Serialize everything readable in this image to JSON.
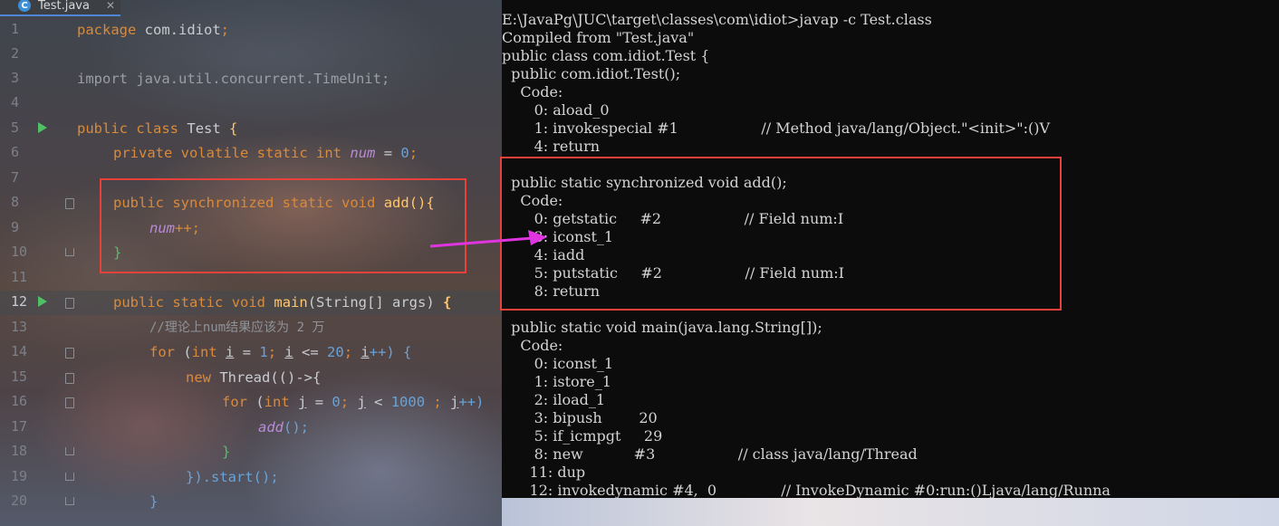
{
  "editor": {
    "tab": {
      "icon": "class-icon",
      "icon_letter": "C",
      "filename": "Test.java"
    },
    "lines": [
      {
        "n": "1"
      },
      {
        "n": "2"
      },
      {
        "n": "3"
      },
      {
        "n": "4"
      },
      {
        "n": "5"
      },
      {
        "n": "6"
      },
      {
        "n": "7"
      },
      {
        "n": "8"
      },
      {
        "n": "9"
      },
      {
        "n": "10"
      },
      {
        "n": "11"
      },
      {
        "n": "12"
      },
      {
        "n": "13"
      },
      {
        "n": "14"
      },
      {
        "n": "15"
      },
      {
        "n": "16"
      },
      {
        "n": "17"
      },
      {
        "n": "18"
      },
      {
        "n": "19"
      },
      {
        "n": "20"
      }
    ],
    "code": {
      "l1": {
        "kw": "package",
        "rest": " com.idiot",
        "semi": ";"
      },
      "l3": {
        "text": "import java.util.concurrent.TimeUnit;"
      },
      "l5": {
        "kw1": "public",
        "kw2": "class",
        "name": "Test",
        "brace": "{"
      },
      "l6": {
        "kw1": "private",
        "kw2": "volatile",
        "kw3": "static",
        "kw4": "int",
        "field": "num",
        "eq": " = ",
        "val": "0",
        "semi": ";"
      },
      "l8": {
        "kw1": "public",
        "kw2": "synchronized",
        "kw3": "static",
        "kw4": "void",
        "fn": "add",
        "tail": "(){"
      },
      "l9": {
        "field": "num",
        "tail": "++;"
      },
      "l10": {
        "text": "}"
      },
      "l12": {
        "kw1": "public",
        "kw2": "static",
        "kw3": "void",
        "fn": "main",
        "params": "(String[] args) ",
        "brace": "{"
      },
      "l13": {
        "text": "//理论上num结果应该为 2 万"
      },
      "l14": {
        "kw": "for",
        "p1": " (",
        "kw2": "int",
        "var": "i",
        "p2": " = ",
        "v1": "1",
        "p3": "; ",
        "var2": "i",
        "p4": " <= ",
        "v2": "20",
        "p5": "; ",
        "var3": "i",
        "p6": "++) {"
      },
      "l15": {
        "kw": "new",
        "rest": " Thread(()->{"
      },
      "l16": {
        "kw": "for",
        "p1": " (",
        "kw2": "int",
        "var": "j",
        "p2": " = ",
        "v1": "0",
        "p3": "; ",
        "var2": "j",
        "p4": " < ",
        "v2": "1000",
        "p5": " ; ",
        "var3": "j",
        "p6": "++)"
      },
      "l17": {
        "fn": "add",
        "tail": "();"
      },
      "l18": {
        "text": "}"
      },
      "l19": {
        "text": "}).start();"
      },
      "l20": {
        "text": "}"
      }
    }
  },
  "terminal": {
    "lines": [
      "E:\\JavaPg\\JUC\\target\\classes\\com\\idiot>javap -c Test.class",
      "Compiled from \"Test.java\"",
      "public class com.idiot.Test {",
      "  public com.idiot.Test();",
      "    Code:",
      "       0: aload_0",
      "       1: invokespecial #1                  // Method java/lang/Object.\"<init>\":()V",
      "       4: return",
      "",
      "  public static synchronized void add();",
      "    Code:",
      "       0: getstatic     #2                  // Field num:I",
      "       3: iconst_1",
      "       4: iadd",
      "       5: putstatic     #2                  // Field num:I",
      "       8: return",
      "",
      "  public static void main(java.lang.String[]);",
      "    Code:",
      "       0: iconst_1",
      "       1: istore_1",
      "       2: iload_1",
      "       3: bipush        20",
      "       5: if_icmpgt     29",
      "       8: new           #3                  // class java/lang/Thread",
      "      11: dup",
      "      12: invokedynamic #4,  0              // InvokeDynamic #0:run:()Ljava/lang/Runna"
    ]
  },
  "annotation": {
    "box_color": "#e8403a",
    "arrow_color": "#e034e0"
  }
}
